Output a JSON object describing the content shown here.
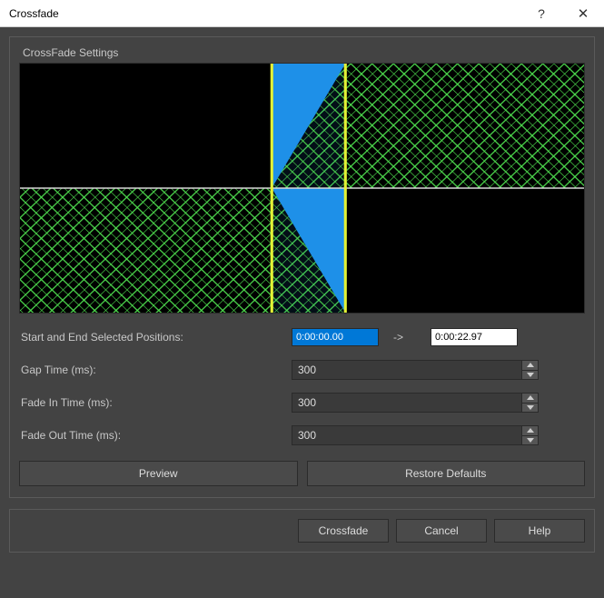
{
  "window": {
    "title": "Crossfade"
  },
  "fieldset": {
    "legend": "CrossFade Settings"
  },
  "positions": {
    "label": "Start and End Selected Positions:",
    "start": "0:00:00.00",
    "arrow": "->",
    "end": "0:00:22.97"
  },
  "gap": {
    "label": "Gap Time (ms):",
    "value": "300"
  },
  "fadein": {
    "label": "Fade In Time (ms):",
    "value": "300"
  },
  "fadeout": {
    "label": "Fade Out Time (ms):",
    "value": "300"
  },
  "buttons": {
    "preview": "Preview",
    "restore": "Restore Defaults",
    "crossfade": "Crossfade",
    "cancel": "Cancel",
    "help": "Help"
  }
}
